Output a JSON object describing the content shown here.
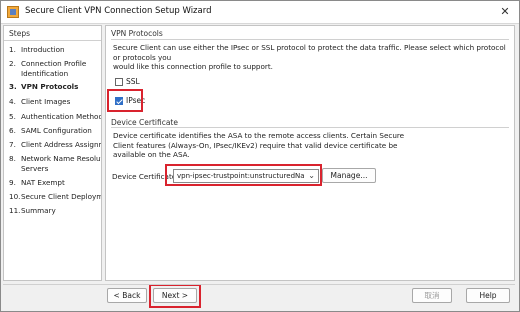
{
  "window": {
    "title": "Secure Client VPN Connection Setup Wizard",
    "close_glyph": "✕"
  },
  "steps": {
    "header": "Steps",
    "items": [
      {
        "num": "1.",
        "label": "Introduction"
      },
      {
        "num": "2.",
        "label": "Connection Profile",
        "label2": "Identification"
      },
      {
        "num": "3.",
        "label": "VPN Protocols"
      },
      {
        "num": "4.",
        "label": "Client Images"
      },
      {
        "num": "5.",
        "label": "Authentication Methods"
      },
      {
        "num": "6.",
        "label": "SAML Configuration"
      },
      {
        "num": "7.",
        "label": "Client Address Assignme"
      },
      {
        "num": "8.",
        "label": "Network Name Resolutio",
        "label2": "Servers"
      },
      {
        "num": "9.",
        "label": "NAT Exempt"
      },
      {
        "num": "10.",
        "label": "Secure Client Deployme"
      },
      {
        "num": "11.",
        "label": "Summary"
      }
    ]
  },
  "vpn_protocols": {
    "header": "VPN Protocols",
    "description_line1": "Secure Client can use either the IPsec or SSL protocol to protect the data traffic. Please select which protocol or protocols you",
    "description_line2": "would like this connection profile to support.",
    "ssl": {
      "label": "SSL",
      "checked": false
    },
    "ipsec": {
      "label": "IPsec",
      "checked": true
    }
  },
  "device_certificate": {
    "header": "Device Certificate",
    "description_line1": "Device certificate identifies the ASA to the remote access clients. Certain Secure",
    "description_line2": "Client features (Always-On, IPsec/IKEv2) require that valid device certificate be",
    "description_line3": "available on the ASA.",
    "field_label": "Device Certificate:",
    "selected_value": "vpn-ipsec-trustpoint:unstructuredNam...",
    "manage_button": "Manage..."
  },
  "footer": {
    "back_button": "< Back",
    "next_button": "Next >",
    "cancel_button": "取消",
    "help_button": "Help"
  },
  "colors": {
    "highlight": "#d9232e",
    "checkbox_checked": "#2f6fc7"
  }
}
